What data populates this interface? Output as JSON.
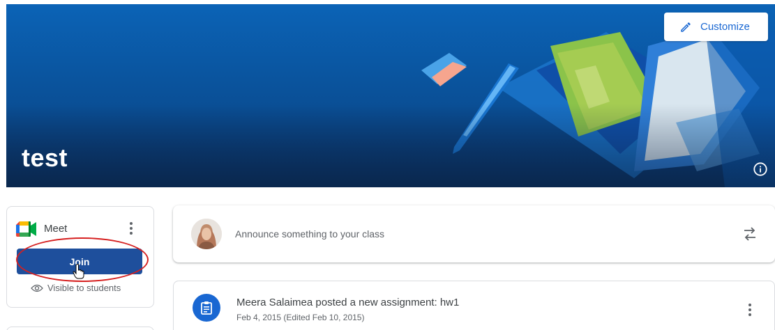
{
  "banner": {
    "title": "test",
    "customize_label": "Customize",
    "colors": {
      "top": "#0b63b6",
      "bottom": "#0a3263"
    }
  },
  "meet": {
    "label": "Meet",
    "join_label": "Join",
    "visibility_text": "Visible to students",
    "icons": [
      "meet-logo-icon",
      "more-vert-icon",
      "eye-icon",
      "hand-cursor-icon"
    ],
    "join_color": "#1e4f9c"
  },
  "announce": {
    "placeholder": "Announce something to your class",
    "icons": [
      "avatar",
      "repost-icon"
    ]
  },
  "stream": {
    "items": [
      {
        "title": "Meera Salaimea posted a new assignment: hw1",
        "date": "Feb 4, 2015 (Edited Feb 10, 2015)"
      }
    ]
  },
  "colors": {
    "accent": "#1967d2",
    "highlight_ring": "#d62020"
  }
}
